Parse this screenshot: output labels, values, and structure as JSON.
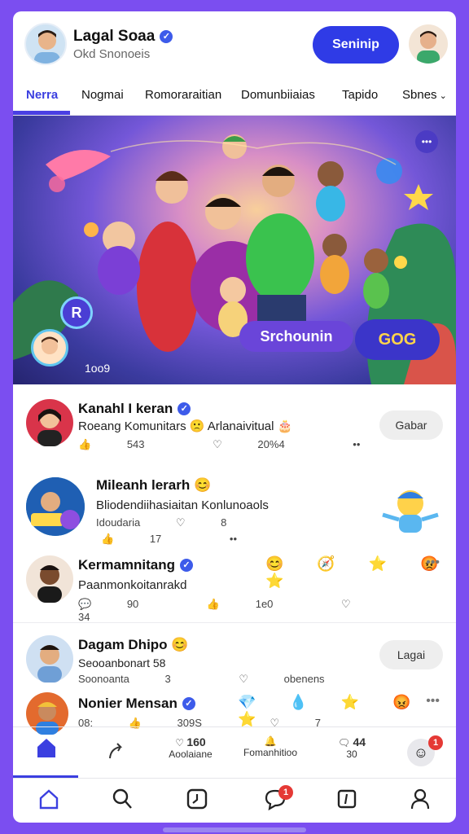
{
  "header": {
    "name": "Lagal Soaa",
    "subtitle": "Okd Snonoeis",
    "signup_label": "Seninip"
  },
  "tabs": [
    "Nerra",
    "Nogmai",
    "Romoraraitian",
    "Domunbiiaias",
    "Tapido",
    "Sbnes"
  ],
  "hero": {
    "chip_label": "Srchounin",
    "chip_badge": "GOG",
    "count": "1oo9",
    "icon_glyph": "R"
  },
  "posts": [
    {
      "title": "Kanahl I keran",
      "text": "Roeang Komunitars 🙁 Arlanaivitual 🎂",
      "likes": "543",
      "hearts": "20%4",
      "action_label": "Gabar"
    },
    {
      "title": "Mileanh lerarh 😊",
      "text": "Bliodendiihasiaitan Konlunoaols",
      "meta_label": "Idoudaria",
      "likes": "17",
      "hearts": "8"
    },
    {
      "title": "Kermamnitang",
      "text": "Paanmonkoitanrakd",
      "comments": "90",
      "likes": "1e0",
      "hearts": "34",
      "emojis": "😊 🧭 ⭐ 😡 ⭐"
    },
    {
      "title": "Dagam Dhipo 😊",
      "text": "Seooanbonart 58",
      "meta_label": "Soonoanta",
      "meta_value": "3",
      "hearts": "obenens",
      "action_label": "Lagai"
    },
    {
      "title": "Nonier Mensan",
      "comments": "08:",
      "likes": "309S",
      "hearts": "7",
      "emojis": "💎 💧 ⭐ 😡 ⭐"
    }
  ],
  "statbar": [
    {
      "num": "160",
      "label": "Aoolaiane"
    },
    {
      "num": "",
      "label": "Fomanhitioo"
    },
    {
      "num": "44",
      "label": "30"
    }
  ],
  "badges": {
    "statbar_badge": "1",
    "nav_badge": "1"
  },
  "colors": {
    "accent": "#3b3fe0",
    "frame": "#7b4ef0",
    "badge": "#e53935"
  }
}
